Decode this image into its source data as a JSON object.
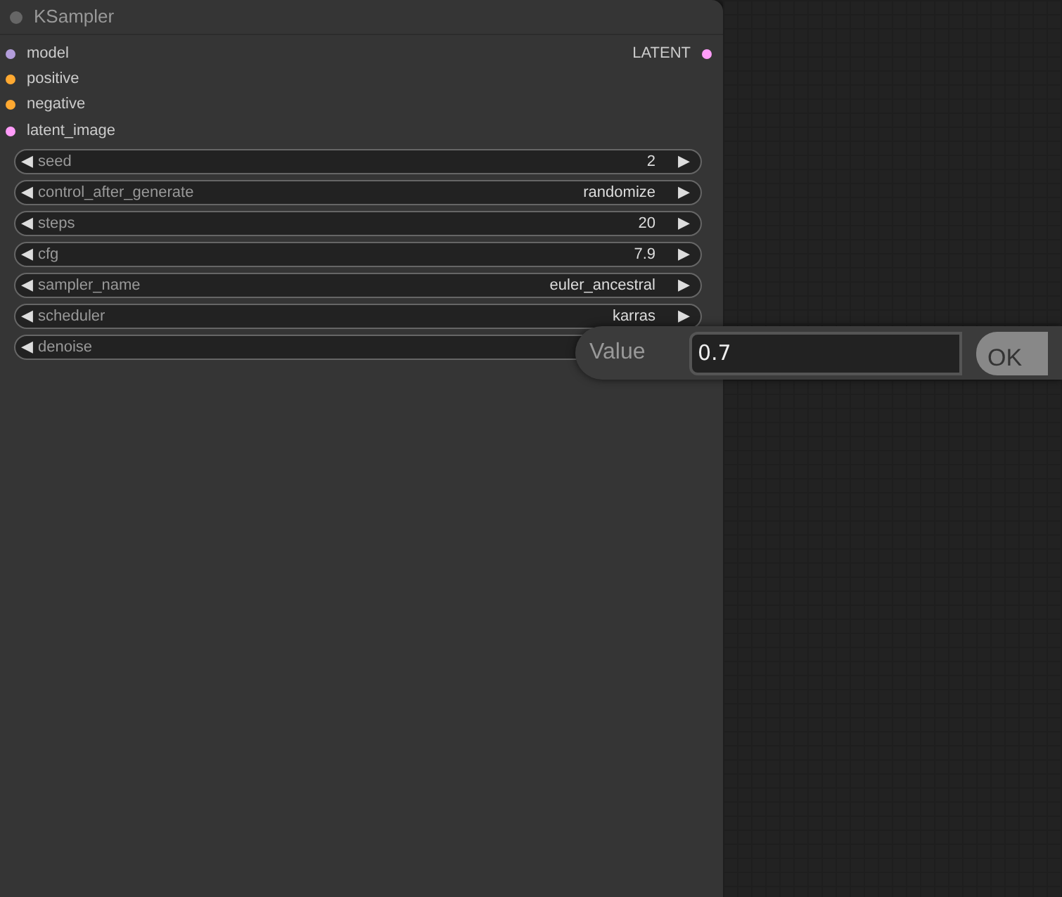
{
  "node": {
    "title": "KSampler",
    "inputs": [
      {
        "label": "model",
        "color": "#b39ddb"
      },
      {
        "label": "positive",
        "color": "#ffa931"
      },
      {
        "label": "negative",
        "color": "#ffa931"
      },
      {
        "label": "latent_image",
        "color": "#ff9cf9"
      }
    ],
    "outputs": [
      {
        "label": "LATENT",
        "color": "#ff9cf9"
      }
    ],
    "widgets": [
      {
        "decrement": "◀",
        "label": "seed",
        "value": "2",
        "increment": "▶"
      },
      {
        "decrement": "◀",
        "label": "control_after_generate",
        "value": "randomize",
        "increment": "▶"
      },
      {
        "decrement": "◀",
        "label": "steps",
        "value": "20",
        "increment": "▶"
      },
      {
        "decrement": "◀",
        "label": "cfg",
        "value": "7.9",
        "increment": "▶"
      },
      {
        "decrement": "◀",
        "label": "sampler_name",
        "value": "euler_ancestral",
        "increment": "▶"
      },
      {
        "decrement": "◀",
        "label": "scheduler",
        "value": "karras",
        "increment": "▶"
      },
      {
        "decrement": "◀",
        "label": "denoise"
      }
    ]
  },
  "dialog": {
    "label": "Value",
    "value": "0.7",
    "button": "OK"
  }
}
